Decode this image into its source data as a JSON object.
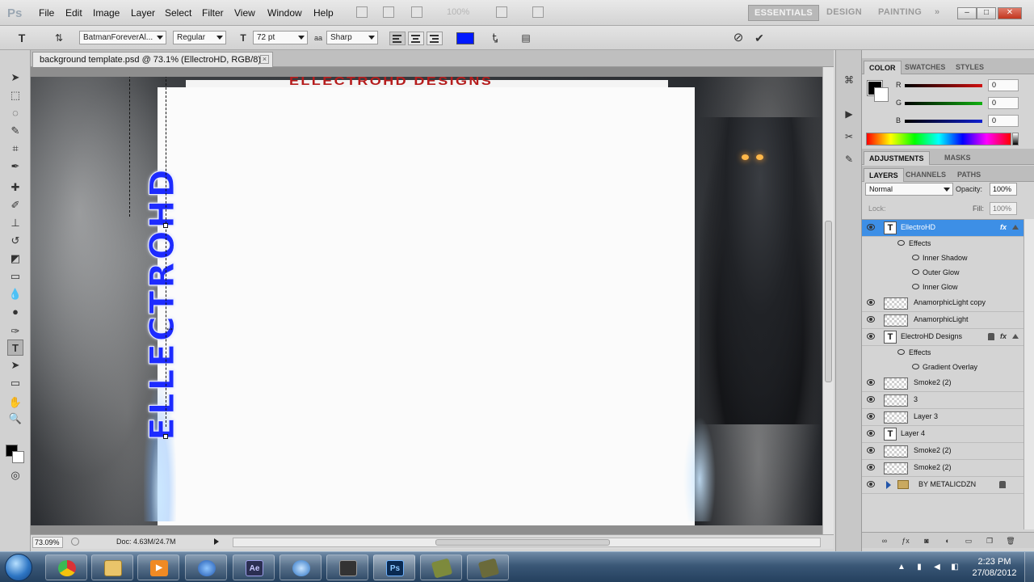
{
  "app": {
    "logo": "Ps",
    "menus": [
      "File",
      "Edit",
      "Image",
      "Layer",
      "Select",
      "Filter",
      "View",
      "Window",
      "Help"
    ],
    "zoom_menu": "100%",
    "workspaces": [
      "ESSENTIALS",
      "DESIGN",
      "PAINTING"
    ],
    "workspace_more": "»",
    "window_controls": [
      "–",
      "□",
      "✕"
    ]
  },
  "options": {
    "font_family": "BatmanForeverAl...",
    "font_style": "Regular",
    "font_size": "72 pt",
    "anti_alias_label": "aa",
    "anti_alias": "Sharp",
    "text_color": "#0019ff",
    "cancel_icon": "⊘",
    "commit_icon": "✔"
  },
  "document": {
    "tab_title": "background template.psd @ 73.1% (EllectroHD, RGB/8)",
    "close": "×",
    "header_text": "ELLECTROHD DESIGNS",
    "vertical_text": "ELLECTROHD",
    "zoom": "73.09%",
    "doc_info": "Doc: 4.63M/24.7M"
  },
  "panels": {
    "color_tabs": [
      "COLOR",
      "SWATCHES",
      "STYLES"
    ],
    "rgb": [
      {
        "label": "R",
        "value": "0",
        "color": "#d01010"
      },
      {
        "label": "G",
        "value": "0",
        "color": "#10b010"
      },
      {
        "label": "B",
        "value": "0",
        "color": "#1020d0"
      }
    ],
    "adjust_tabs": [
      "ADJUSTMENTS",
      "MASKS"
    ],
    "layer_tabs": [
      "LAYERS",
      "CHANNELS",
      "PATHS"
    ],
    "blend_mode": "Normal",
    "opacity_label": "Opacity:",
    "opacity": "100%",
    "lock_label": "Lock:",
    "fill_label": "Fill:",
    "fill": "100%"
  },
  "layers": [
    {
      "name": "EllectroHD",
      "type": "text",
      "selected": true,
      "fx": "fx"
    },
    {
      "name": "Effects",
      "type": "effects"
    },
    {
      "name": "Inner Shadow",
      "type": "effect"
    },
    {
      "name": "Outer Glow",
      "type": "effect"
    },
    {
      "name": "Inner Glow",
      "type": "effect"
    },
    {
      "name": "AnamorphicLight copy",
      "type": "image"
    },
    {
      "name": "AnamorphicLight",
      "type": "image"
    },
    {
      "name": "ElectroHD Designs",
      "type": "text",
      "fx": "fx",
      "locked": true
    },
    {
      "name": "Effects",
      "type": "effects"
    },
    {
      "name": "Gradient Overlay",
      "type": "effect"
    },
    {
      "name": "Smoke2 (2)",
      "type": "image"
    },
    {
      "name": "3",
      "type": "image"
    },
    {
      "name": "Layer 3",
      "type": "image"
    },
    {
      "name": "Layer 4",
      "type": "text"
    },
    {
      "name": "Smoke2 (2)",
      "type": "image"
    },
    {
      "name": "Smoke2 (2)",
      "type": "image"
    },
    {
      "name": "BY METALICDZN",
      "type": "group",
      "locked": true
    }
  ],
  "taskbar": {
    "time": "2:23 PM",
    "date": "27/08/2012",
    "apps": [
      "chrome",
      "explorer",
      "media-player",
      "network",
      "after-effects",
      "steam",
      "camtasia",
      "photoshop",
      "archive",
      "archive-2"
    ],
    "ae_label": "Ae",
    "ps_label": "Ps"
  }
}
